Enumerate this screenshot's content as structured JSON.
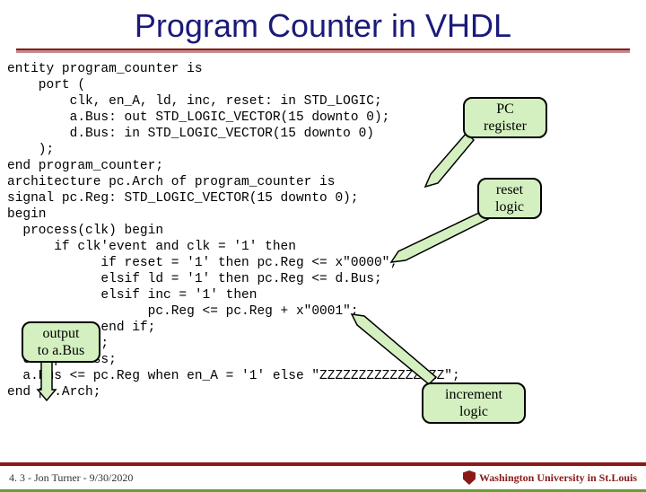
{
  "title": "Program Counter in VHDL",
  "code_lines": [
    "entity program_counter is",
    "    port (",
    "        clk, en_A, ld, inc, reset: in STD_LOGIC;",
    "        a.Bus: out STD_LOGIC_VECTOR(15 downto 0);",
    "        d.Bus: in STD_LOGIC_VECTOR(15 downto 0)",
    "    );",
    "end program_counter;",
    "architecture pc.Arch of program_counter is",
    "signal pc.Reg: STD_LOGIC_VECTOR(15 downto 0);",
    "begin",
    "  process(clk) begin",
    "      if clk'event and clk = '1' then",
    "            if reset = '1' then pc.Reg <= x\"0000\";",
    "            elsif ld = '1' then pc.Reg <= d.Bus;",
    "            elsif inc = '1' then",
    "                  pc.Reg <= pc.Reg + x\"0001\";",
    "            end if;",
    "      end if;",
    "  end process;",
    "  a.Bus <= pc.Reg when en_A = '1' else \"ZZZZZZZZZZZZZZZZ\";",
    "end pc.Arch;"
  ],
  "callouts": {
    "pc": "PC\nregister",
    "reset": "reset\nlogic",
    "output": "output\nto a.Bus",
    "inc": "increment\nlogic"
  },
  "footer": {
    "left": "4. 3 - Jon Turner - 9/30/2020",
    "uni": "Washington University in St.Louis"
  }
}
